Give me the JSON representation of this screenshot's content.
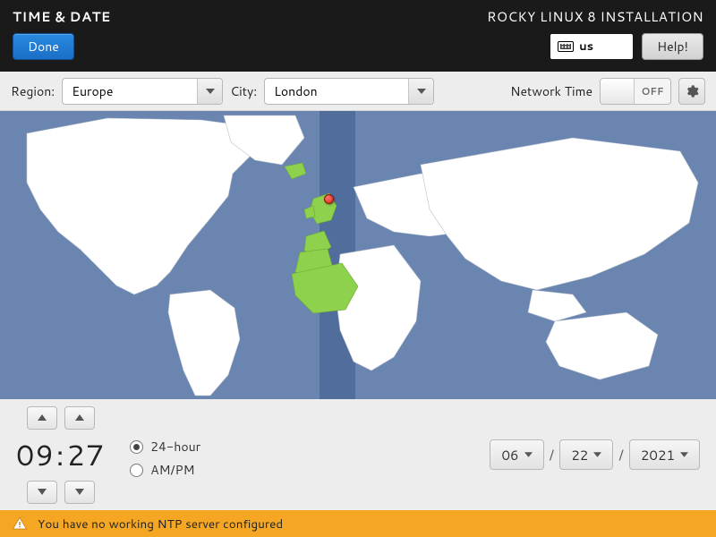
{
  "header": {
    "title": "TIME & DATE",
    "product": "ROCKY LINUX 8 INSTALLATION",
    "done_label": "Done",
    "help_label": "Help!",
    "keyboard_layout": "us"
  },
  "controls": {
    "region_label": "Region:",
    "region_value": "Europe",
    "city_label": "City:",
    "city_value": "London",
    "network_time_label": "Network Time",
    "network_time_state": "OFF",
    "network_time_on": false
  },
  "map": {
    "selected_city": "London",
    "selected_region": "Europe",
    "highlight_color": "#8ed14c",
    "pin_color": "#d8231a"
  },
  "time": {
    "hours": "09",
    "minutes": "27",
    "separator": ":"
  },
  "format": {
    "opt_24h": "24-hour",
    "opt_ampm": "AM/PM",
    "selected": "24-hour"
  },
  "date": {
    "month": "06",
    "day": "22",
    "year": "2021",
    "sep": "/"
  },
  "warning": {
    "text": "You have no working NTP server configured"
  }
}
